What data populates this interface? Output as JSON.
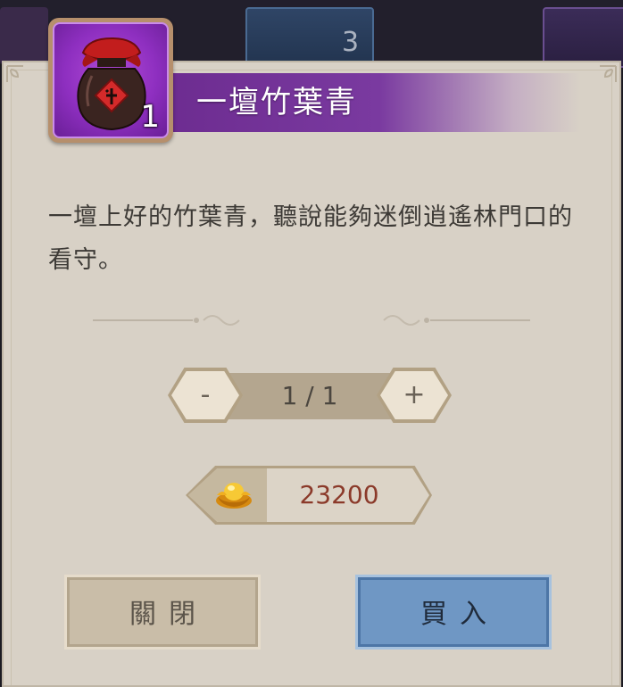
{
  "background": {
    "slot_count": "3"
  },
  "dialog": {
    "title": "一壇竹葉青",
    "item": {
      "icon": "wine-jar-icon",
      "quantity": "1"
    },
    "description": "一壇上好的竹葉青，聽說能夠迷倒逍遙林門口的看守。",
    "stepper": {
      "minus_label": "-",
      "plus_label": "+",
      "value": "1 / 1"
    },
    "price": {
      "currency_icon": "gold-ingot-icon",
      "amount": "23200"
    },
    "buttons": {
      "close_label": "關閉",
      "buy_label": "買入"
    }
  },
  "colors": {
    "title_bar": "#7a3aa0",
    "price_text": "#8b3a2a",
    "buy_button": "#6f97c4",
    "panel": "#d8d1c6"
  }
}
